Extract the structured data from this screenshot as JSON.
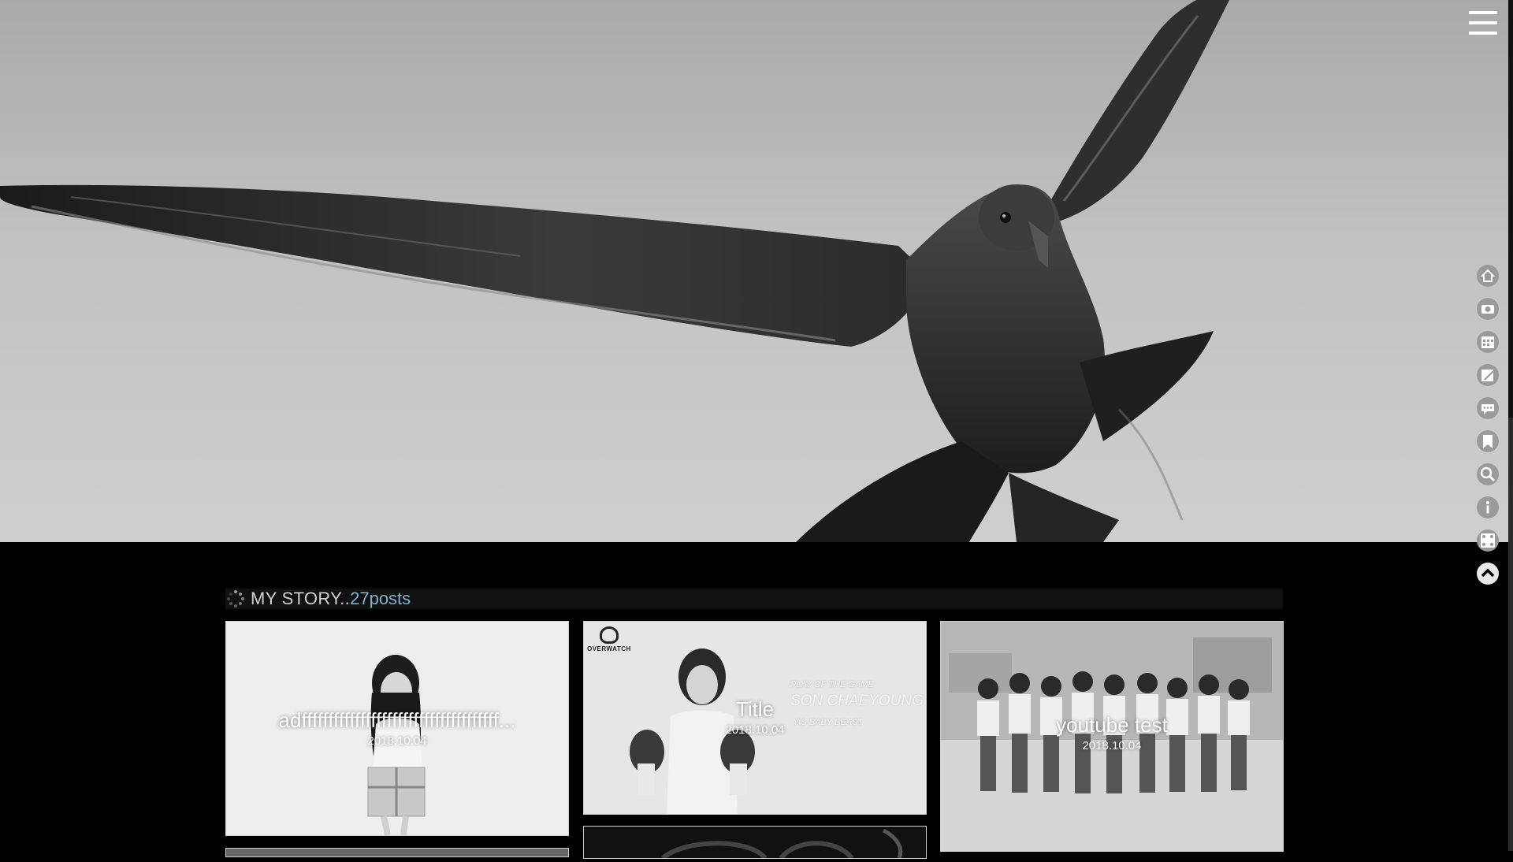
{
  "menu": {
    "icon": "hamburger-icon"
  },
  "side_nav": [
    {
      "name": "home",
      "icon": "home-icon"
    },
    {
      "name": "photo",
      "icon": "camera-icon"
    },
    {
      "name": "calendar",
      "icon": "calendar-icon"
    },
    {
      "name": "notes",
      "icon": "note-edit-icon"
    },
    {
      "name": "guestbook",
      "icon": "speech-bubble-icon"
    },
    {
      "name": "bookmark",
      "icon": "bookmark-icon"
    },
    {
      "name": "search",
      "icon": "search-icon"
    },
    {
      "name": "info",
      "icon": "info-icon"
    },
    {
      "name": "random",
      "icon": "dice-icon"
    },
    {
      "name": "top",
      "icon": "chevron-up-icon"
    }
  ],
  "section": {
    "title": "MY STORY..",
    "count": "27posts"
  },
  "posts": [
    {
      "title": "adfffffffffffffffffffffffffffffffffffff...",
      "date": "2018.10.04"
    },
    {
      "title": "Title",
      "date": "2018.10.04",
      "promo": {
        "logo": "OVERWATCH",
        "line1": "PLAY OF THE GAME",
        "line2": "SON CHAEYOUNG",
        "line3": "AS BABY BEAST"
      }
    },
    {
      "title": "youtube test",
      "date": "2018.10.04"
    }
  ],
  "colors": {
    "accent_count": "#7fb3c8",
    "background": "#000000"
  }
}
